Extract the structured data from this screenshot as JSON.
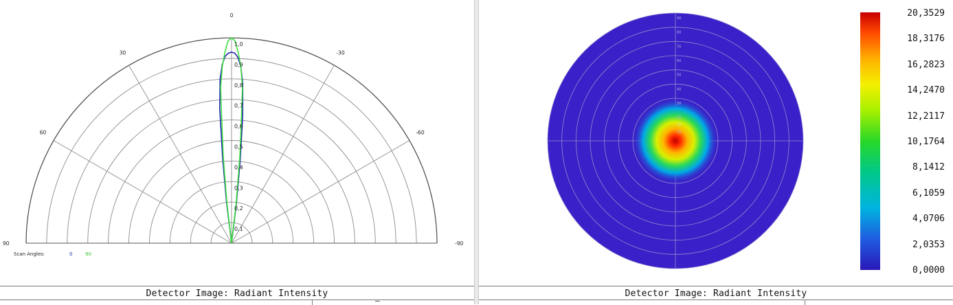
{
  "chart_data": [
    {
      "type": "polar-line",
      "angle_labels": [
        {
          "deg": 0,
          "text": "0"
        },
        {
          "deg": 30,
          "text": "30"
        },
        {
          "deg": -30,
          "text": "-30"
        },
        {
          "deg": 60,
          "text": "60"
        },
        {
          "deg": -60,
          "text": "-60"
        },
        {
          "deg": 90,
          "text": "90"
        },
        {
          "deg": -90,
          "text": "-90"
        }
      ],
      "radial_ticks": [
        "0,1",
        "0,2",
        "0,3",
        "0,4",
        "0,5",
        "0,6",
        "0,7",
        "0,8",
        "0,9",
        "1,0"
      ],
      "radial_tick_values": [
        0.1,
        0.2,
        0.3,
        0.4,
        0.5,
        0.6,
        0.7,
        0.8,
        0.9,
        1.0
      ],
      "rlim": [
        0,
        1.0
      ],
      "theta_range": [
        -90,
        90
      ],
      "grid": true,
      "legend": {
        "title": "Scan Angles:",
        "position": "bottom-left"
      },
      "series": [
        {
          "name": "0",
          "color": "#1f25b0",
          "points": [
            [
              -8,
              0.0
            ],
            [
              -7,
              0.19
            ],
            [
              -6,
              0.4
            ],
            [
              -5,
              0.62
            ],
            [
              -4,
              0.78
            ],
            [
              -3,
              0.86
            ],
            [
              -2,
              0.905
            ],
            [
              -1,
              0.925
            ],
            [
              0,
              0.93
            ],
            [
              1,
              0.925
            ],
            [
              2,
              0.91
            ],
            [
              3,
              0.87
            ],
            [
              4,
              0.8
            ],
            [
              5,
              0.66
            ],
            [
              6,
              0.42
            ],
            [
              7,
              0.2
            ],
            [
              8,
              0.0
            ]
          ]
        },
        {
          "name": "90",
          "color": "#3fe03f",
          "points": [
            [
              -7.5,
              0.0
            ],
            [
              -6.5,
              0.2
            ],
            [
              -5.5,
              0.42
            ],
            [
              -4.5,
              0.62
            ],
            [
              -4,
              0.76
            ],
            [
              -3,
              0.86
            ],
            [
              -2,
              0.93
            ],
            [
              -1,
              0.985
            ],
            [
              0,
              1.0
            ],
            [
              1,
              0.985
            ],
            [
              2,
              0.93
            ],
            [
              3,
              0.86
            ],
            [
              4,
              0.76
            ],
            [
              4.5,
              0.62
            ],
            [
              5.5,
              0.42
            ],
            [
              6.5,
              0.2
            ],
            [
              7.5,
              0.0
            ]
          ]
        }
      ]
    },
    {
      "type": "heatmap",
      "projection": "polar",
      "radial_labels": [
        "10",
        "20",
        "30",
        "40",
        "50",
        "60",
        "70",
        "80",
        "90"
      ],
      "center_label": "10",
      "colorbar": {
        "min": 0.0,
        "max": 20.3529,
        "labels": [
          "20,3529",
          "18,3176",
          "16,2823",
          "14,2470",
          "12,2117",
          "10,1764",
          "8,1412",
          "6,1059",
          "4,0706",
          "2,0353",
          "0,0000"
        ]
      },
      "background_value": 0.5,
      "peak_value": 20.3529,
      "hotspot_width_deg": 5
    }
  ],
  "footers": {
    "left": "Detector Image: Radiant Intensity",
    "right": "Detector Image: Radiant Intensity",
    "left_cut_glyph": "–"
  },
  "colors": {
    "grid": "#8c8c8c",
    "outer": "#555555",
    "disk_bg": "#3a20c8",
    "disk_grid": "#8f8bd0"
  }
}
